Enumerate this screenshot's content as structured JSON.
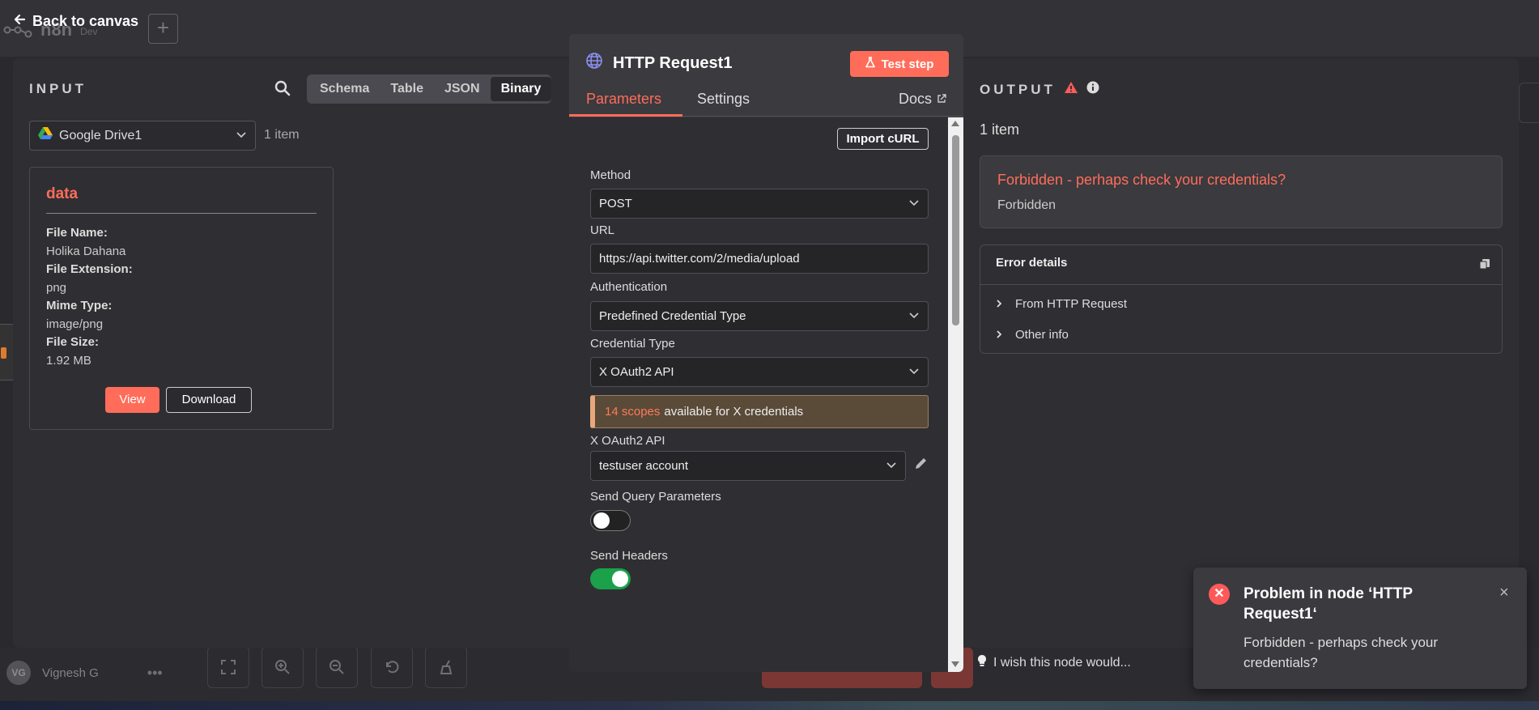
{
  "colors": {
    "accent": "#ff6d5a",
    "success": "#1aa14a",
    "panel": "#2f2f33",
    "warning_border": "#e8a87c"
  },
  "header": {
    "back_label": "Back to canvas",
    "brand": "n8n",
    "env": "Dev",
    "add_label": "+"
  },
  "input": {
    "title": "INPUT",
    "view_tabs": [
      "Schema",
      "Table",
      "JSON",
      "Binary"
    ],
    "active_view": "Binary",
    "source_node": "Google Drive1",
    "item_count": "1 item",
    "card": {
      "title": "data",
      "fields": [
        {
          "key": "File Name:",
          "value": "Holika Dahana"
        },
        {
          "key": "File Extension:",
          "value": "png"
        },
        {
          "key": "Mime Type:",
          "value": "image/png"
        },
        {
          "key": "File Size:",
          "value": "1.92 MB"
        }
      ],
      "view_label": "View",
      "download_label": "Download"
    }
  },
  "node": {
    "title": "HTTP Request1",
    "test_label": "Test step",
    "tabs": [
      "Parameters",
      "Settings"
    ],
    "docs_label": "Docs",
    "import_label": "Import cURL",
    "method": {
      "label": "Method",
      "value": "POST"
    },
    "url": {
      "label": "URL",
      "value": "https://api.twitter.com/2/media/upload"
    },
    "authentication": {
      "label": "Authentication",
      "value": "Predefined Credential Type"
    },
    "credential_type": {
      "label": "Credential Type",
      "value": "X OAuth2 API"
    },
    "notice": {
      "highlight": "14 scopes",
      "rest": "available for X credentials"
    },
    "credential": {
      "label": "X OAuth2 API",
      "value": "testuser account"
    },
    "send_query": {
      "label": "Send Query Parameters",
      "enabled": false
    },
    "send_headers": {
      "label": "Send Headers",
      "enabled": true
    }
  },
  "output": {
    "title": "OUTPUT",
    "item_count": "1 item",
    "error_title": "Forbidden - perhaps check your credentials?",
    "error_sub": "Forbidden",
    "details_title": "Error details",
    "details_rows": [
      "From HTTP Request",
      "Other info"
    ]
  },
  "footer": {
    "avatar_initials": "VG",
    "user_name": "Vignesh G",
    "more": "•••",
    "wish_text": "I wish this node would..."
  },
  "toast": {
    "title": "Problem in node ‘HTTP Request1‘",
    "message": "Forbidden - perhaps check your credentials?",
    "close": "×"
  }
}
